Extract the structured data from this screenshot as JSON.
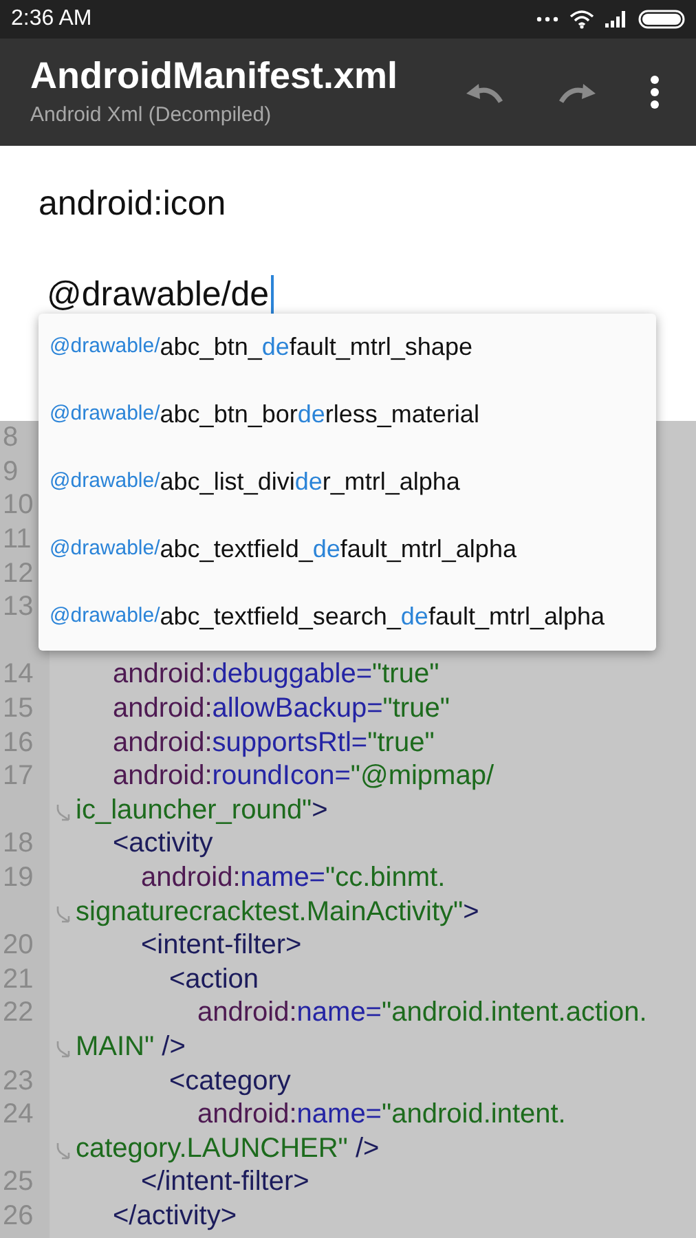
{
  "status_bar": {
    "time": "2:36 AM"
  },
  "toolbar": {
    "title": "AndroidManifest.xml",
    "subtitle": "Android Xml (Decompiled)"
  },
  "dialog": {
    "label": "android:icon",
    "value": "@drawable/de"
  },
  "suggestions": [
    {
      "prefix": "@drawable/",
      "parts": [
        {
          "text": "abc_btn_",
          "match": false
        },
        {
          "text": "de",
          "match": true
        },
        {
          "text": "fault_mtrl_shape",
          "match": false
        }
      ]
    },
    {
      "prefix": "@drawable/",
      "parts": [
        {
          "text": "abc_btn_bor",
          "match": false
        },
        {
          "text": "de",
          "match": true
        },
        {
          "text": "rless_material",
          "match": false
        }
      ]
    },
    {
      "prefix": "@drawable/",
      "parts": [
        {
          "text": "abc_list_divi",
          "match": false
        },
        {
          "text": "de",
          "match": true
        },
        {
          "text": "r_mtrl_alpha",
          "match": false
        }
      ]
    },
    {
      "prefix": "@drawable/",
      "parts": [
        {
          "text": "abc_textfield_",
          "match": false
        },
        {
          "text": "de",
          "match": true
        },
        {
          "text": "fault_mtrl_alpha",
          "match": false
        }
      ]
    },
    {
      "prefix": "@drawable/",
      "parts": [
        {
          "text": "abc_textfield_search_",
          "match": false
        },
        {
          "text": "de",
          "match": true
        },
        {
          "text": "fault_mtrl_alpha",
          "match": false
        }
      ]
    }
  ],
  "code_lines": [
    {
      "number": "8"
    },
    {
      "number": "9"
    },
    {
      "number": "10"
    },
    {
      "number": "11"
    },
    {
      "number": "12"
    },
    {
      "number": "13",
      "wrapped": true,
      "children": [
        {
          "number": "14",
          "segments": [
            {
              "kind": "ns",
              "text": "android:"
            },
            {
              "kind": "attr",
              "text": "debuggable="
            },
            {
              "kind": "value",
              "text": "\"true\""
            }
          ]
        },
        {
          "number": "15",
          "segments": [
            {
              "kind": "ns",
              "text": "android:"
            },
            {
              "kind": "attr",
              "text": "allowBackup="
            },
            {
              "kind": "value",
              "text": "\"true\""
            }
          ]
        },
        {
          "number": "16",
          "segments": [
            {
              "kind": "ns",
              "text": "android:"
            },
            {
              "kind": "attr",
              "text": "supportsRtl="
            },
            {
              "kind": "value",
              "text": "\"true\""
            }
          ]
        },
        {
          "number": "17",
          "segments": [
            {
              "kind": "ns",
              "text": "android:"
            },
            {
              "kind": "attr",
              "text": "roundIcon="
            },
            {
              "kind": "value",
              "text": "\"@mipmap/"
            }
          ],
          "wrap": [
            {
              "kind": "value",
              "text": "ic_launcher_round\""
            },
            {
              "kind": "tag",
              "text": ">"
            }
          ]
        },
        {
          "number": "18",
          "segments": [
            {
              "kind": "tag",
              "text": "<activity"
            }
          ],
          "children": [
            {
              "number": "19",
              "segments": [
                {
                  "kind": "ns",
                  "text": "android:"
                },
                {
                  "kind": "attr",
                  "text": "name="
                },
                {
                  "kind": "value",
                  "text": "\"cc.binmt."
                }
              ],
              "wrap": [
                {
                  "kind": "value",
                  "text": "signaturecracktest.MainActivity\""
                },
                {
                  "kind": "tag",
                  "text": ">"
                }
              ]
            },
            {
              "number": "20",
              "segments": [
                {
                  "kind": "tag",
                  "text": "<intent-filter>"
                }
              ],
              "children": [
                {
                  "number": "21",
                  "segments": [
                    {
                      "kind": "tag",
                      "text": "<action"
                    }
                  ],
                  "children": [
                    {
                      "number": "22",
                      "segments": [
                        {
                          "kind": "ns",
                          "text": "android:"
                        },
                        {
                          "kind": "attr",
                          "text": "name="
                        },
                        {
                          "kind": "value",
                          "text": "\"android.intent.action."
                        }
                      ],
                      "wrap": [
                        {
                          "kind": "value",
                          "text": "MAIN\""
                        },
                        {
                          "kind": "tag",
                          "text": " />"
                        }
                      ]
                    }
                  ]
                },
                {
                  "number": "23",
                  "segments": [
                    {
                      "kind": "tag",
                      "text": "<category"
                    }
                  ],
                  "children": [
                    {
                      "number": "24",
                      "segments": [
                        {
                          "kind": "ns",
                          "text": "android:"
                        },
                        {
                          "kind": "attr",
                          "text": "name="
                        },
                        {
                          "kind": "value",
                          "text": "\"android.intent."
                        }
                      ],
                      "wrap": [
                        {
                          "kind": "value",
                          "text": "category.LAUNCHER\""
                        },
                        {
                          "kind": "tag",
                          "text": " />"
                        }
                      ]
                    }
                  ]
                }
              ]
            },
            {
              "number": "25",
              "segments": [
                {
                  "kind": "tag",
                  "text": "</intent-filter>"
                }
              ]
            }
          ]
        },
        {
          "number": "26",
          "segments": [
            {
              "kind": "tag",
              "text": "</activity>"
            }
          ]
        }
      ]
    }
  ]
}
